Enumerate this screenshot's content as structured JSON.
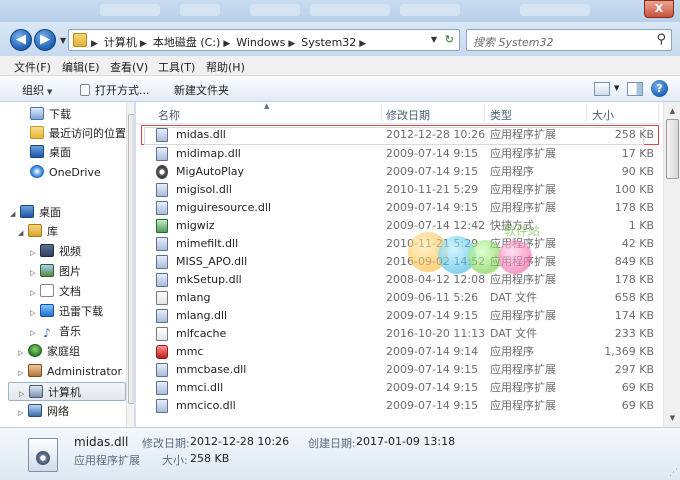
{
  "window": {
    "close_label": "X"
  },
  "nav": {
    "back_glyph": "◀",
    "forward_glyph": "▶",
    "breadcrumbs": [
      "计算机",
      "本地磁盘 (C:)",
      "Windows",
      "System32"
    ],
    "search_placeholder": "搜索 System32"
  },
  "menu": [
    "文件(F)",
    "编辑(E)",
    "查看(V)",
    "工具(T)",
    "帮助(H)"
  ],
  "toolbar": {
    "organize": "组织",
    "open_with": "打开方式...",
    "new_folder": "新建文件夹",
    "help_glyph": "?"
  },
  "sidebar": {
    "items": [
      {
        "label": "下载",
        "icon": "download-icon"
      },
      {
        "label": "最近访问的位置",
        "icon": "recent-places-icon"
      },
      {
        "label": "桌面",
        "icon": "desktop-icon"
      },
      {
        "label": "OneDrive",
        "icon": "onedrive-icon"
      },
      {
        "label": "桌面",
        "icon": "desktop-icon"
      },
      {
        "label": "库",
        "icon": "library-icon"
      },
      {
        "label": "视频",
        "icon": "video-icon"
      },
      {
        "label": "图片",
        "icon": "picture-icon"
      },
      {
        "label": "文档",
        "icon": "document-icon"
      },
      {
        "label": "迅雷下载",
        "icon": "xunlei-icon"
      },
      {
        "label": "音乐",
        "icon": "music-icon"
      },
      {
        "label": "家庭组",
        "icon": "homegroup-icon"
      },
      {
        "label": "Administrator",
        "icon": "user-icon"
      },
      {
        "label": "计算机",
        "icon": "computer-icon"
      },
      {
        "label": "网络",
        "icon": "network-icon"
      }
    ]
  },
  "columns": {
    "name": "名称",
    "date": "修改日期",
    "type": "类型",
    "size": "大小"
  },
  "files": [
    {
      "name": "midas.dll",
      "date": "2012-12-28 10:26",
      "type": "应用程序扩展",
      "size": "258 KB"
    },
    {
      "name": "midimap.dll",
      "date": "2009-07-14 9:15",
      "type": "应用程序扩展",
      "size": "17 KB"
    },
    {
      "name": "MigAutoPlay",
      "date": "2009-07-14 9:15",
      "type": "应用程序",
      "size": "90 KB"
    },
    {
      "name": "migisol.dll",
      "date": "2010-11-21 5:29",
      "type": "应用程序扩展",
      "size": "100 KB"
    },
    {
      "name": "miguiresource.dll",
      "date": "2009-07-14 9:15",
      "type": "应用程序扩展",
      "size": "178 KB"
    },
    {
      "name": "migwiz",
      "date": "2009-07-14 12:42",
      "type": "快捷方式",
      "size": "1 KB"
    },
    {
      "name": "mimefilt.dll",
      "date": "2010-11-21 5:29",
      "type": "应用程序扩展",
      "size": "42 KB"
    },
    {
      "name": "MISS_APO.dll",
      "date": "2016-09-02 14:52",
      "type": "应用程序扩展",
      "size": "849 KB"
    },
    {
      "name": "mkSetup.dll",
      "date": "2008-04-12 12:08",
      "type": "应用程序扩展",
      "size": "178 KB"
    },
    {
      "name": "mlang",
      "date": "2009-06-11 5:26",
      "type": "DAT 文件",
      "size": "658 KB"
    },
    {
      "name": "mlang.dll",
      "date": "2009-07-14 9:15",
      "type": "应用程序扩展",
      "size": "174 KB"
    },
    {
      "name": "mlfcache",
      "date": "2016-10-20 11:13",
      "type": "DAT 文件",
      "size": "233 KB"
    },
    {
      "name": "mmc",
      "date": "2009-07-14 9:14",
      "type": "应用程序",
      "size": "1,369 KB"
    },
    {
      "name": "mmcbase.dll",
      "date": "2009-07-14 9:15",
      "type": "应用程序扩展",
      "size": "297 KB"
    },
    {
      "name": "mmci.dll",
      "date": "2009-07-14 9:15",
      "type": "应用程序扩展",
      "size": "69 KB"
    },
    {
      "name": "mmcico.dll",
      "date": "2009-07-14 9:15",
      "type": "应用程序扩展",
      "size": "69 KB"
    }
  ],
  "watermark": {
    "text": "软件站"
  },
  "details": {
    "file_name": "midas.dll",
    "file_type": "应用程序扩展",
    "modified_label": "修改日期:",
    "modified_value": "2012-12-28 10:26",
    "created_label": "创建日期:",
    "created_value": "2017-01-09 13:18",
    "size_label": "大小:",
    "size_value": "258 KB"
  },
  "colors": {
    "highlight_outline": "#e04848",
    "accent": "#1c5fb4"
  }
}
